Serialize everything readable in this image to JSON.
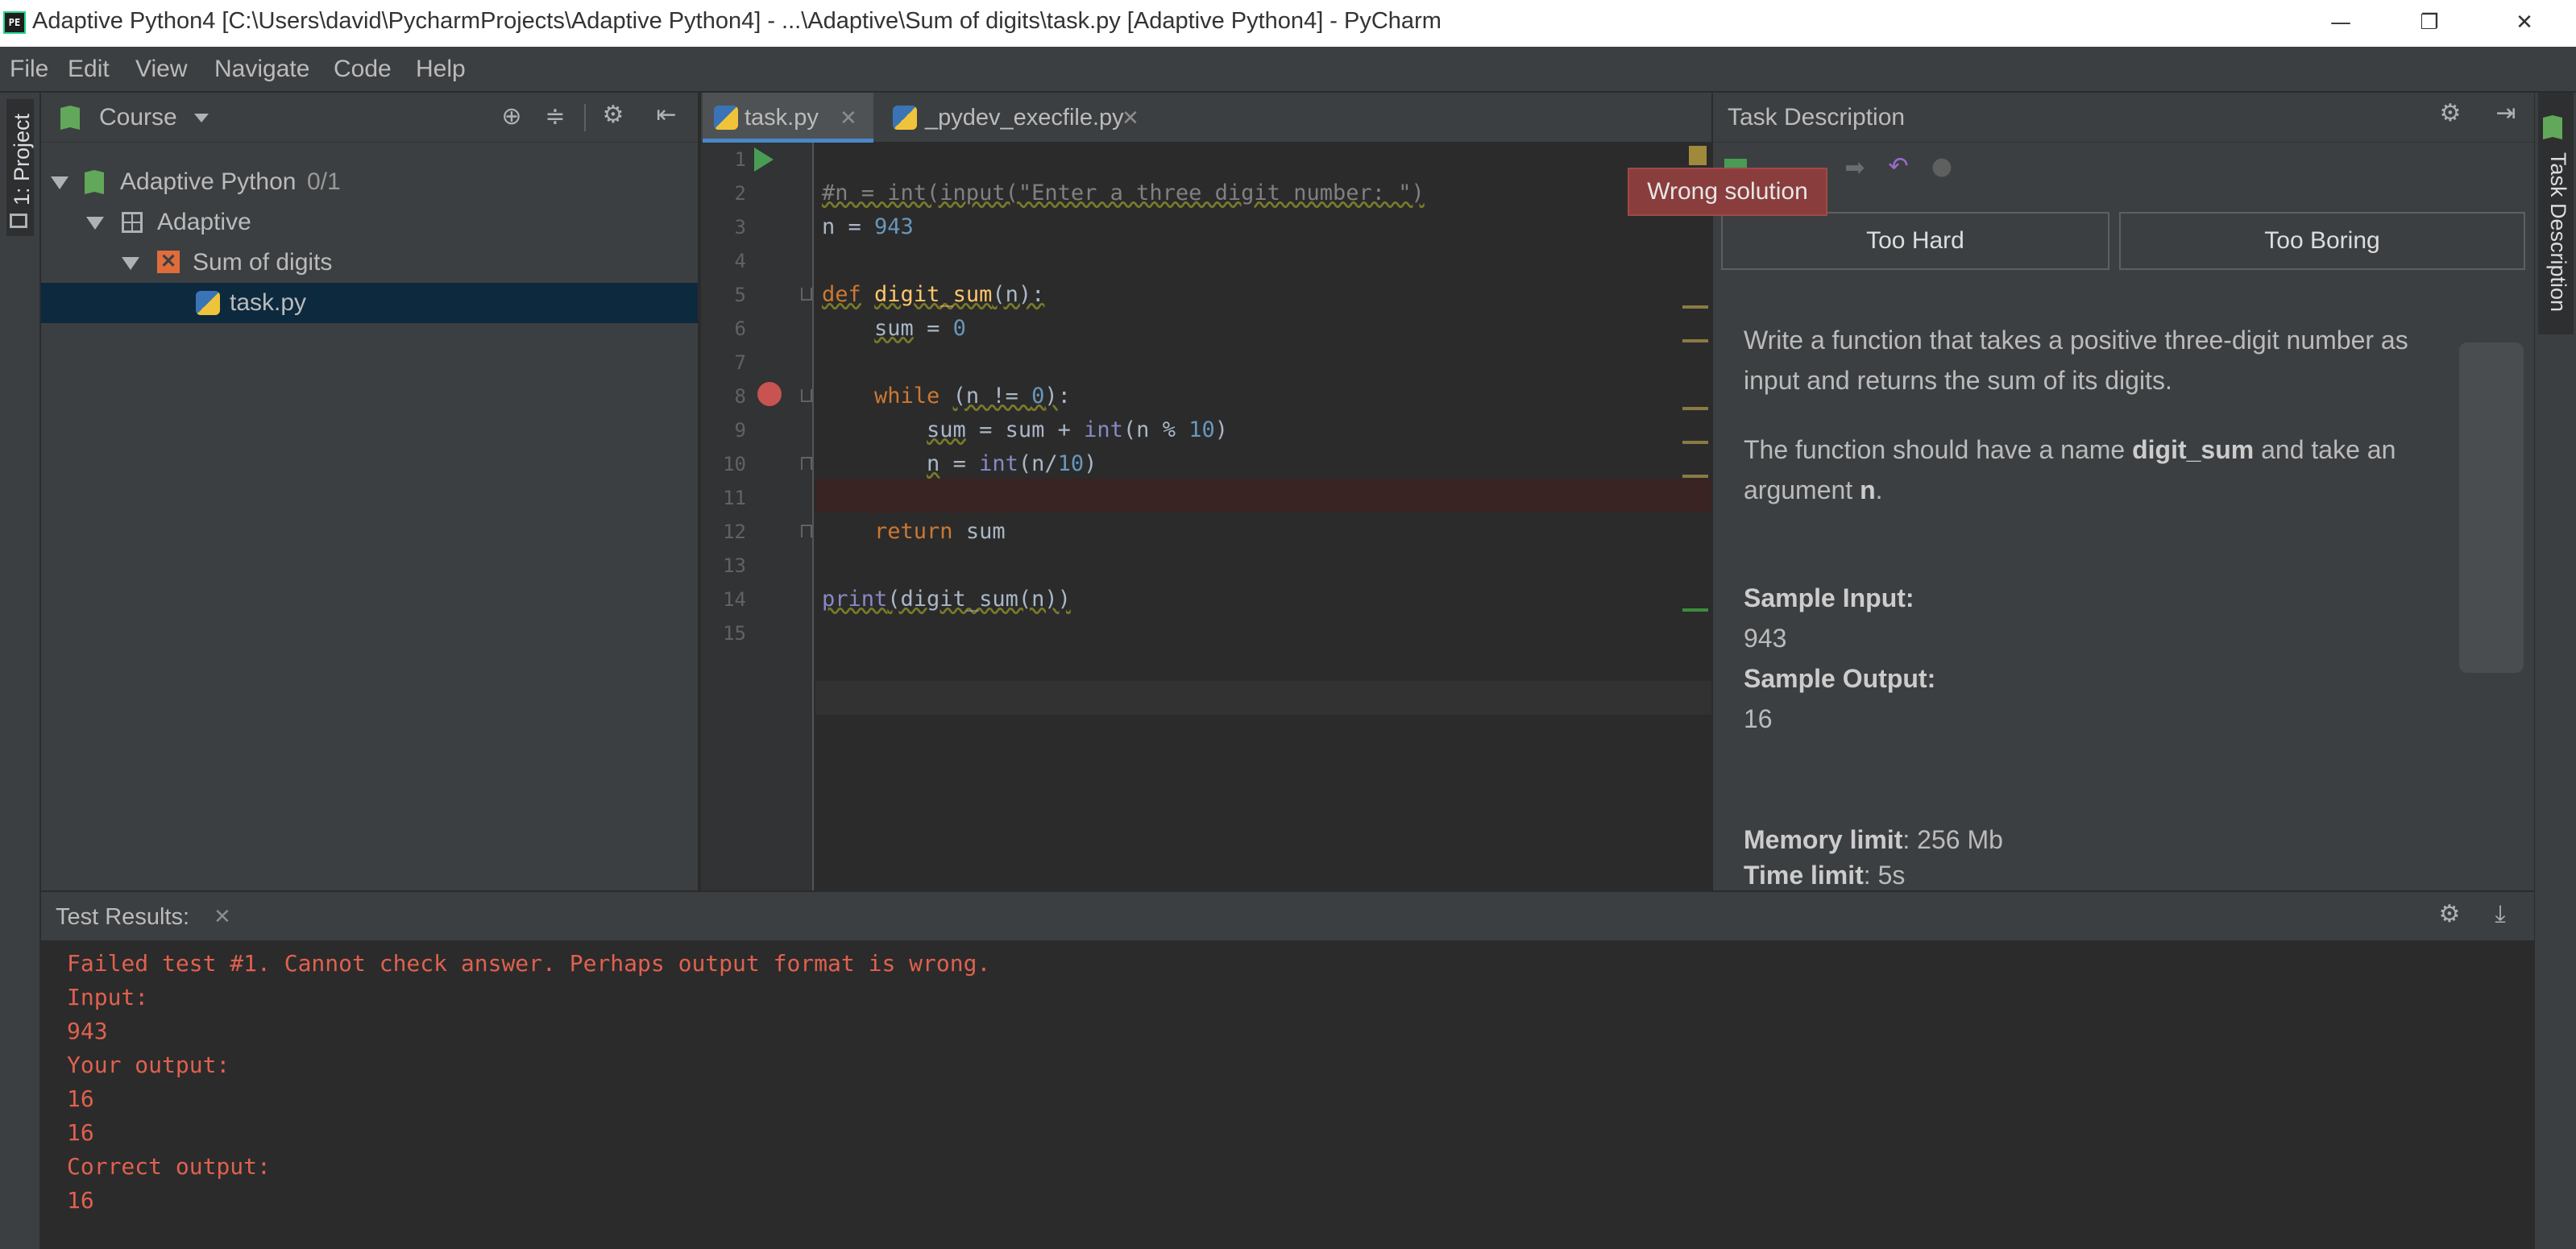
{
  "window": {
    "app_icon_text": "PE",
    "title": "Adaptive Python4 [C:\\Users\\david\\PycharmProjects\\Adaptive Python4] - ...\\Adaptive\\Sum of digits\\task.py [Adaptive Python4] - PyCharm",
    "minimize": "—",
    "restore": "❐",
    "close": "✕"
  },
  "menu": [
    "File",
    "Edit",
    "View",
    "Navigate",
    "Code",
    "Help"
  ],
  "left_strip": {
    "project_label": "1: Project"
  },
  "right_strip": {
    "task_label": "Task Description"
  },
  "project": {
    "view_label": "Course",
    "tree": [
      {
        "label": "Adaptive Python",
        "count": "0/1",
        "icon": "course-icon"
      },
      {
        "label": "Adaptive",
        "icon": "lesson-icon"
      },
      {
        "label": "Sum of digits",
        "icon": "task-failed-icon"
      },
      {
        "label": "task.py",
        "icon": "python-file-icon"
      }
    ]
  },
  "editor": {
    "tabs": [
      {
        "label": "task.py",
        "active": true
      },
      {
        "label": "_pydev_execfile.py",
        "active": false
      }
    ],
    "line_numbers": [
      "1",
      "2",
      "3",
      "4",
      "5",
      "6",
      "7",
      "8",
      "9",
      "10",
      "11",
      "12",
      "13",
      "14",
      "15"
    ]
  },
  "task_description": {
    "title": "Task Description",
    "tooltip": "Wrong solution",
    "too_hard": "Too Hard",
    "too_boring": "Too Boring",
    "para1": "Write a function that takes a positive three-digit number as input and returns the sum of its digits.",
    "para2_prefix": "The function should have a name ",
    "para2_name": "digit_sum",
    "para2_mid": " and take an argument ",
    "para2_arg": "n",
    "para2_end": ".",
    "sample_input_label": "Sample Input:",
    "sample_input": "943",
    "sample_output_label": "Sample Output:",
    "sample_output": "16",
    "memory_label": "Memory limit",
    "memory_value": ": 256 Mb",
    "time_label": "Time limit",
    "time_value": ": 5s"
  },
  "test_results": {
    "title": "Test Results:",
    "lines": [
      "Failed test #1. Cannot check answer. Perhaps output format is wrong.",
      "Input:",
      "943",
      "Your output:",
      "16",
      "16",
      "Correct output:",
      "16"
    ]
  },
  "colors": {
    "accent": "#4a88c7",
    "error": "#e0614f",
    "run": "#499c54",
    "breakpoint": "#c75450"
  }
}
